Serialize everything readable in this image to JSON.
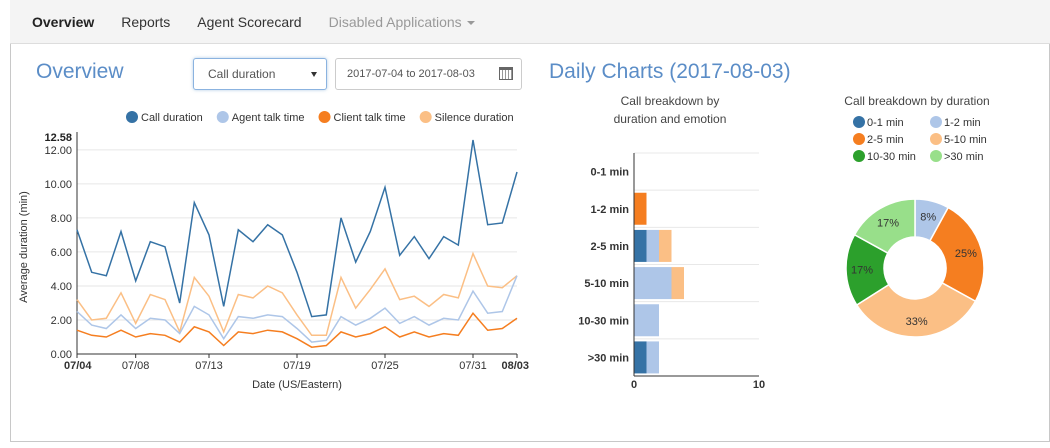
{
  "nav": {
    "items": [
      {
        "label": "Overview",
        "active": true
      },
      {
        "label": "Reports"
      },
      {
        "label": "Agent Scorecard"
      },
      {
        "label": "Disabled Applications",
        "disabled": true
      }
    ]
  },
  "overview": {
    "title": "Overview",
    "metric_select": "Call duration",
    "date_range": "2017-07-04 to 2017-08-03"
  },
  "daily": {
    "title": "Daily Charts (2017-08-03)"
  },
  "colors": {
    "call_duration": "#3572a5",
    "agent_talk": "#aec6e8",
    "client_talk": "#f57e20",
    "silence": "#fbbf85",
    "dark_green": "#2ca02c",
    "light_green": "#98df8a",
    "accent": "#5b8dc7"
  },
  "chart_data": [
    {
      "type": "line",
      "title": "",
      "xlabel": "Date (US/Eastern)",
      "ylabel": "Average duration (min)",
      "ylim": [
        0,
        12.58
      ],
      "yticks": [
        "0.00",
        "2.00",
        "4.00",
        "6.00",
        "8.00",
        "10.00",
        "12.00"
      ],
      "ymax_label": "12.58",
      "xticks": [
        "07/04",
        "07/08",
        "07/13",
        "07/19",
        "07/25",
        "07/31",
        "08/03"
      ],
      "x": [
        "07/04",
        "07/05",
        "07/06",
        "07/07",
        "07/08",
        "07/09",
        "07/10",
        "07/11",
        "07/12",
        "07/13",
        "07/14",
        "07/15",
        "07/16",
        "07/17",
        "07/18",
        "07/19",
        "07/20",
        "07/21",
        "07/22",
        "07/23",
        "07/24",
        "07/25",
        "07/26",
        "07/27",
        "07/28",
        "07/29",
        "07/30",
        "07/31",
        "08/01",
        "08/02",
        "08/03"
      ],
      "legend_position": "top",
      "series": [
        {
          "name": "Call duration",
          "color": "#3572a5",
          "values": [
            7.3,
            4.8,
            4.6,
            7.2,
            4.3,
            6.6,
            6.3,
            3.0,
            8.9,
            7.0,
            2.8,
            7.3,
            6.6,
            7.6,
            7.0,
            4.8,
            2.2,
            2.3,
            8.0,
            5.4,
            7.2,
            9.8,
            5.8,
            6.9,
            5.6,
            6.9,
            6.4,
            12.58,
            7.6,
            7.7,
            10.7
          ]
        },
        {
          "name": "Agent talk time",
          "color": "#aec6e8",
          "values": [
            2.5,
            1.7,
            1.5,
            2.3,
            1.5,
            2.1,
            2.0,
            1.2,
            2.8,
            2.3,
            0.9,
            2.2,
            2.1,
            2.3,
            2.2,
            1.5,
            0.7,
            0.8,
            2.2,
            1.7,
            2.1,
            2.7,
            1.8,
            2.2,
            1.7,
            2.1,
            2.0,
            3.7,
            2.4,
            2.5,
            4.6
          ]
        },
        {
          "name": "Client talk time",
          "color": "#f57e20",
          "values": [
            1.4,
            1.1,
            1.0,
            1.4,
            1.0,
            1.2,
            1.1,
            0.7,
            1.6,
            1.3,
            0.5,
            1.3,
            1.2,
            1.4,
            1.3,
            0.9,
            0.4,
            0.5,
            1.3,
            1.0,
            1.2,
            1.6,
            1.0,
            1.3,
            1.0,
            1.2,
            1.1,
            2.4,
            1.4,
            1.5,
            2.1
          ]
        },
        {
          "name": "Silence duration",
          "color": "#fbbf85",
          "values": [
            3.2,
            2.0,
            2.1,
            3.6,
            1.8,
            3.5,
            3.2,
            1.3,
            4.5,
            3.4,
            1.3,
            3.5,
            3.3,
            4.0,
            3.6,
            2.3,
            1.1,
            1.1,
            4.5,
            2.7,
            3.8,
            5.0,
            3.2,
            3.4,
            2.8,
            3.5,
            3.3,
            5.9,
            4.0,
            3.9,
            4.6
          ]
        }
      ]
    },
    {
      "type": "bar",
      "orientation": "horizontal",
      "stacked": true,
      "title": "Call breakdown by duration and emotion",
      "title_lines": [
        "Call breakdown by",
        "duration and emotion"
      ],
      "categories": [
        "0-1 min",
        "1-2 min",
        "2-5 min",
        "5-10 min",
        "10-30 min",
        ">30 min"
      ],
      "xlim": [
        0,
        10
      ],
      "xticks": [
        "0",
        "10"
      ],
      "series": [
        {
          "color": "#3572a5",
          "values": [
            0,
            0,
            1,
            0,
            0,
            1
          ]
        },
        {
          "color": "#f57e20",
          "values": [
            0,
            1,
            0,
            0,
            0,
            0
          ]
        },
        {
          "color": "#aec6e8",
          "values": [
            0,
            0,
            1,
            3,
            2,
            1
          ]
        },
        {
          "color": "#fbbf85",
          "values": [
            0,
            0,
            1,
            1,
            0,
            0
          ]
        }
      ]
    },
    {
      "type": "pie",
      "donut": true,
      "title": "Call breakdown by duration",
      "legend_position": "top",
      "labels": [
        "0-1 min",
        "1-2 min",
        "2-5 min",
        "5-10 min",
        "10-30 min",
        ">30 min"
      ],
      "colors": [
        "#3572a5",
        "#aec6e8",
        "#f57e20",
        "#fbbf85",
        "#2ca02c",
        "#98df8a"
      ],
      "values": [
        0,
        8,
        25,
        33,
        17,
        17
      ],
      "value_labels": [
        "",
        "8%",
        "25%",
        "33%",
        "17%",
        "17%"
      ]
    }
  ]
}
